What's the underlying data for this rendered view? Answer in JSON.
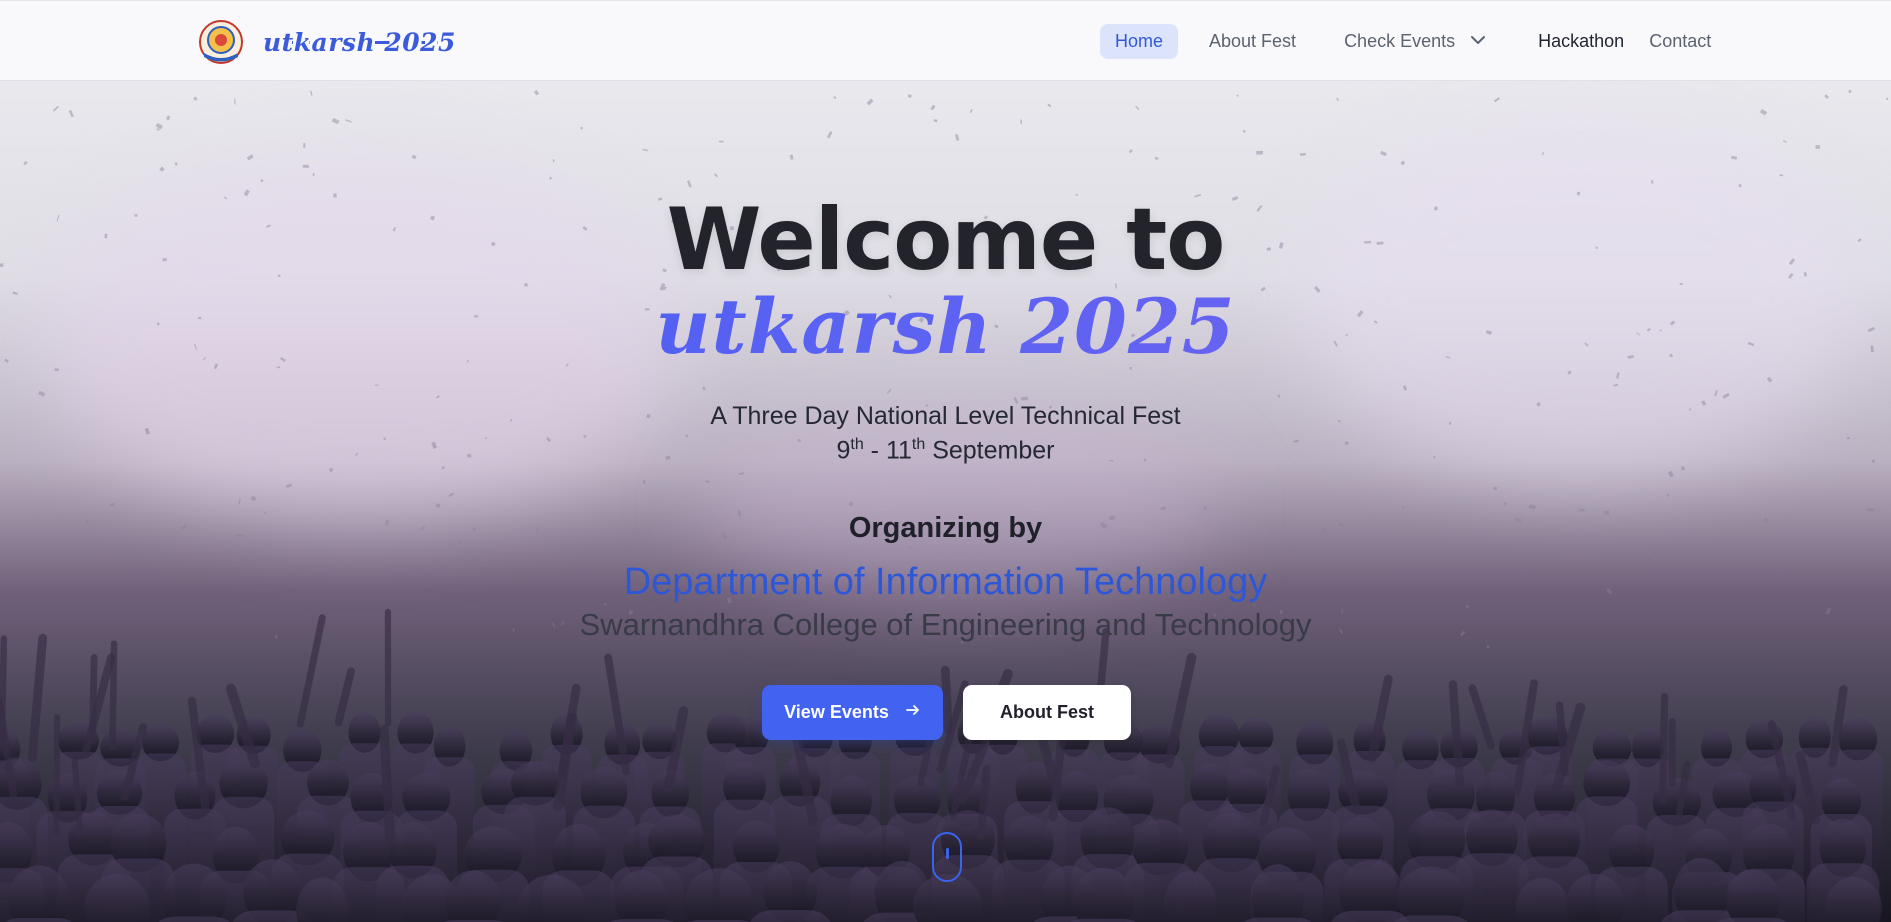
{
  "brand": {
    "name": "utkarsh 2025",
    "logo_icon": "college-crest"
  },
  "nav": {
    "items": [
      {
        "label": "Home",
        "state": "active"
      },
      {
        "label": "About Fest"
      },
      {
        "label": "Check Events",
        "has_dropdown": true
      },
      {
        "label": "Hackathon"
      },
      {
        "label": "Contact"
      }
    ]
  },
  "hero": {
    "welcome": "Welcome to",
    "fest_name": "utkarsh 2025",
    "tagline": "A Three Day National Level Technical Fest",
    "date_start_day": "9",
    "date_start_suffix": "th",
    "date_separator": " - ",
    "date_end_day": "11",
    "date_end_suffix": "th",
    "date_month": " September",
    "organizing_label": "Organizing by",
    "department": "Department of Information Technology",
    "college": "Swarnandhra College of Engineering and Technology",
    "primary_button": "View Events",
    "secondary_button": "About Fest"
  },
  "colors": {
    "accent": "#4163f0",
    "nav_active_bg": "#dbe4fb",
    "department_text": "#2e57d6",
    "heading_text": "#22232b"
  }
}
